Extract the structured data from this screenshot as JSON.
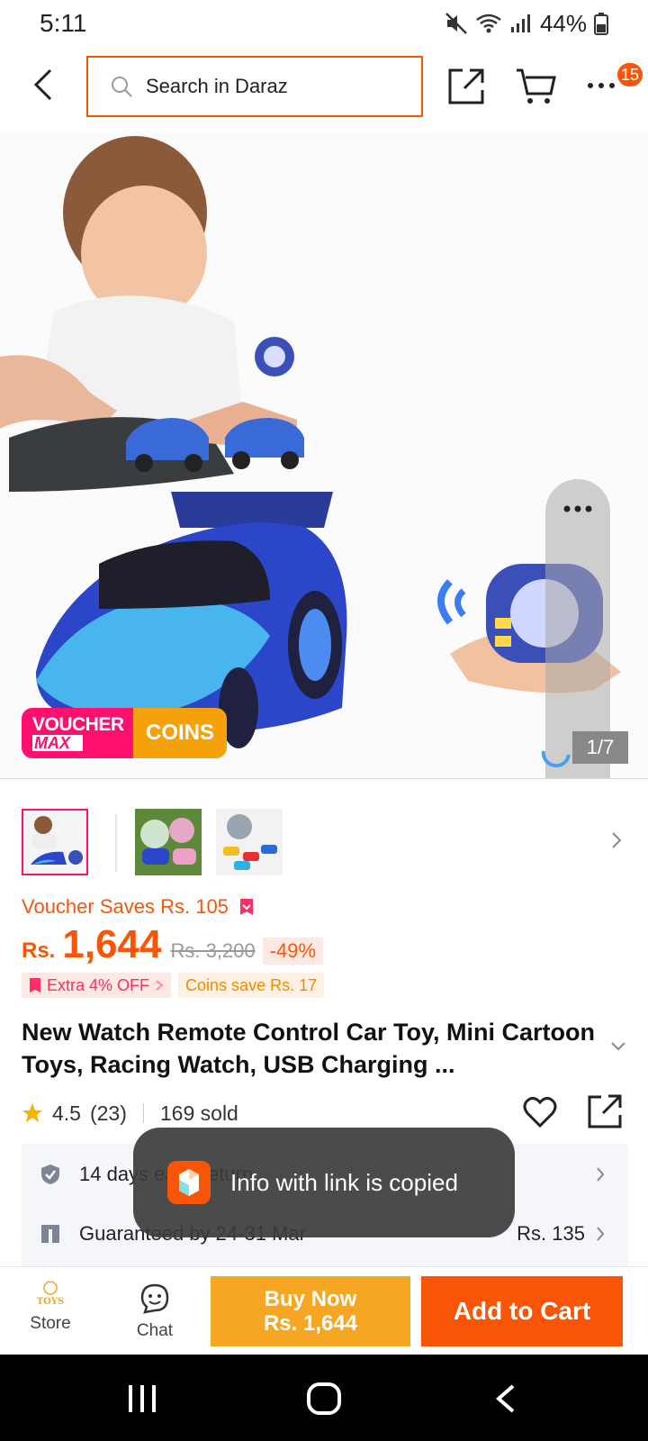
{
  "status_bar": {
    "time": "5:11",
    "battery": "44%",
    "icons": [
      "mute-icon",
      "wifi-icon",
      "signal-icon",
      "battery-icon"
    ]
  },
  "header": {
    "search_placeholder": "Search in Daraz",
    "notification_count": "15"
  },
  "colors": {
    "brand": "#f85606",
    "voucher_pink": "#ff0f6e",
    "coins_orange": "#f5a20a",
    "buy_now": "#f5a623"
  },
  "hero": {
    "voucher_badge_line1": "VOUCHER",
    "voucher_badge_line2": "MAX",
    "coins_badge": "COINS",
    "image_counter": "1/7"
  },
  "price": {
    "voucher_saves": "Voucher Saves Rs. 105",
    "currency": "Rs.",
    "current": "1,644",
    "original": "Rs. 3,200",
    "discount": "-49%",
    "promo_extra": "Extra 4% OFF",
    "promo_coins": "Coins save Rs. 17"
  },
  "product": {
    "title": "New Watch Remote Control Car Toy, Mini Cartoon Toys, Racing Watch, USB Charging ...",
    "rating": "4.5",
    "reviews": "(23)",
    "sold": "169 sold"
  },
  "services": {
    "returns": "14 days easy return",
    "delivery": "Guaranteed by 24-31 Mar",
    "delivery_fee": "Rs. 135"
  },
  "toast": {
    "message": "Info with link is copied"
  },
  "action_bar": {
    "store_label": "Store",
    "store_logo_text": "TOYS",
    "chat_label": "Chat",
    "buy_now_label": "Buy Now",
    "buy_now_price": "Rs. 1,644",
    "add_to_cart_label": "Add to Cart"
  }
}
